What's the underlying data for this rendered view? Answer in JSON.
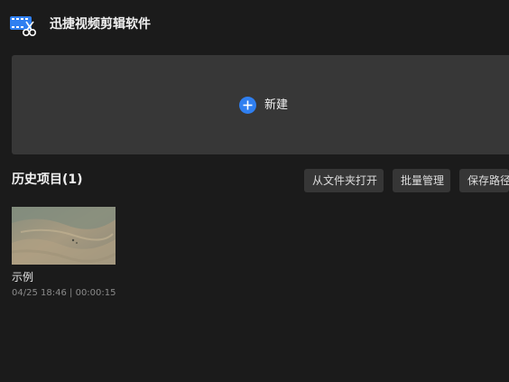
{
  "app": {
    "title": "迅捷视频剪辑软件",
    "logo_icon": "video-scissors-logo-icon"
  },
  "new_project": {
    "label": "新建",
    "icon": "plus-circle-icon",
    "accent_color": "#2f7ff0"
  },
  "history": {
    "title": "历史项目(1)",
    "actions": {
      "open_folder": "从文件夹打开",
      "batch_manage": "批量管理",
      "save_path": "保存路径"
    },
    "projects": [
      {
        "name": "示例",
        "date": "04/25 18:46",
        "separator": "|",
        "duration": "00:00:15",
        "thumbnail": "sand-dunes-thumbnail"
      }
    ]
  }
}
